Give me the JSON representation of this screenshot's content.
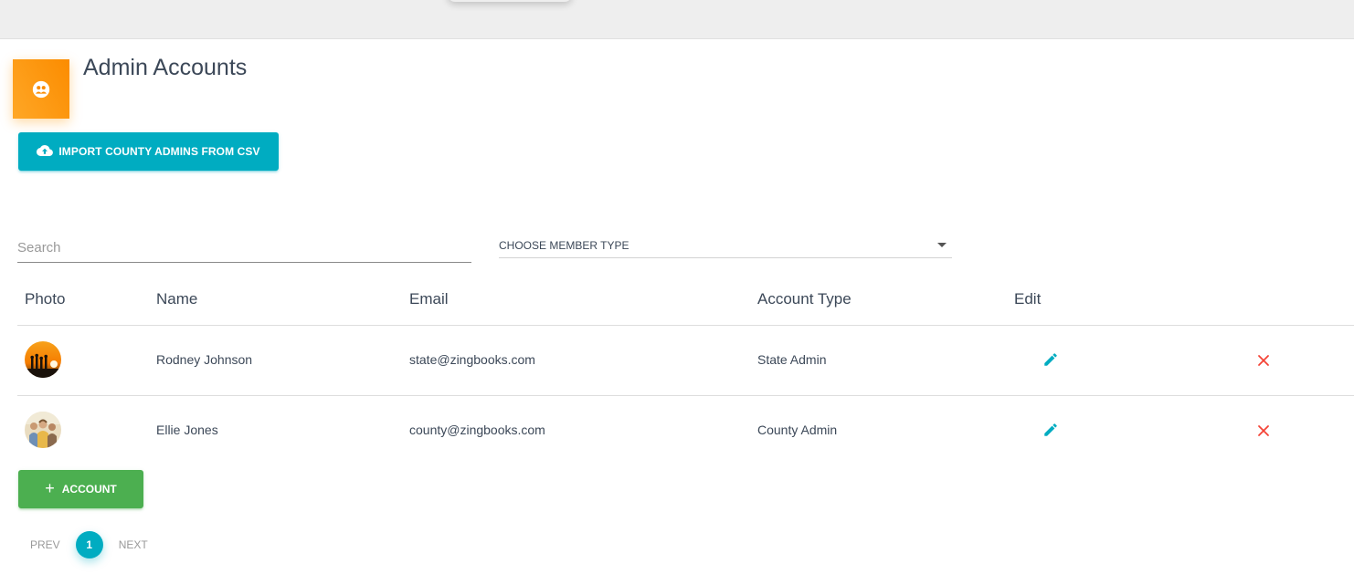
{
  "page": {
    "title": "Admin Accounts",
    "icon": "supervisor-account-icon",
    "accent_color": "#ff9800"
  },
  "toolbar": {
    "import_label": "IMPORT COUNTY ADMINS FROM CSV",
    "import_icon": "cloud-upload-icon",
    "import_color": "#00acc1"
  },
  "filters": {
    "search_placeholder": "Search",
    "search_value": "",
    "member_type_label": "CHOOSE MEMBER TYPE"
  },
  "table": {
    "headers": [
      "Photo",
      "Name",
      "Email",
      "Account Type",
      "Edit"
    ],
    "rows": [
      {
        "photo": "sunset-group-photo",
        "name": "Rodney Johnson",
        "email": "state@zingbooks.com",
        "account_type": "State Admin"
      },
      {
        "photo": "family-group-photo",
        "name": "Ellie Jones",
        "email": "county@zingbooks.com",
        "account_type": "County Admin"
      }
    ],
    "edit_icon": "pencil-icon",
    "delete_icon": "close-icon",
    "edit_color": "#00acc1",
    "delete_color": "#f44336"
  },
  "add_account": {
    "label": "ACCOUNT",
    "icon": "plus-icon",
    "color": "#4caf50"
  },
  "pagination": {
    "prev": "PREV",
    "current": "1",
    "next": "NEXT"
  }
}
